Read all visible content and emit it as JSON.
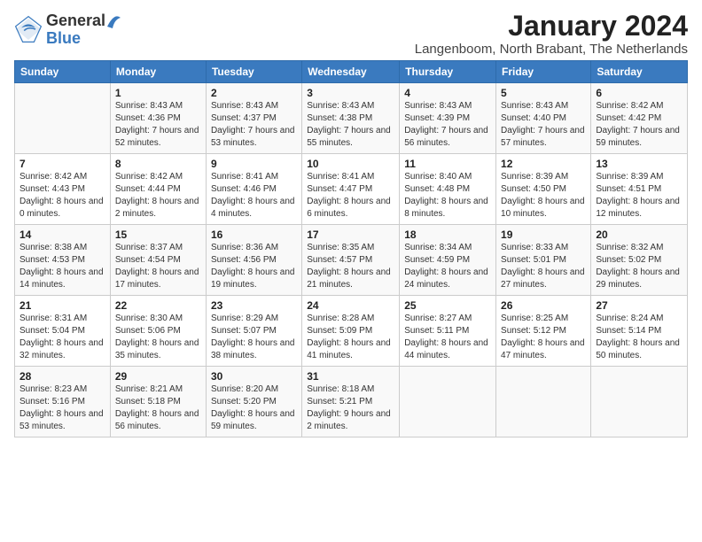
{
  "logo": {
    "general": "General",
    "blue": "Blue"
  },
  "title": "January 2024",
  "location": "Langenboom, North Brabant, The Netherlands",
  "weekdays": [
    "Sunday",
    "Monday",
    "Tuesday",
    "Wednesday",
    "Thursday",
    "Friday",
    "Saturday"
  ],
  "weeks": [
    [
      {
        "day": "",
        "sunrise": "",
        "sunset": "",
        "daylight": ""
      },
      {
        "day": "1",
        "sunrise": "Sunrise: 8:43 AM",
        "sunset": "Sunset: 4:36 PM",
        "daylight": "Daylight: 7 hours and 52 minutes."
      },
      {
        "day": "2",
        "sunrise": "Sunrise: 8:43 AM",
        "sunset": "Sunset: 4:37 PM",
        "daylight": "Daylight: 7 hours and 53 minutes."
      },
      {
        "day": "3",
        "sunrise": "Sunrise: 8:43 AM",
        "sunset": "Sunset: 4:38 PM",
        "daylight": "Daylight: 7 hours and 55 minutes."
      },
      {
        "day": "4",
        "sunrise": "Sunrise: 8:43 AM",
        "sunset": "Sunset: 4:39 PM",
        "daylight": "Daylight: 7 hours and 56 minutes."
      },
      {
        "day": "5",
        "sunrise": "Sunrise: 8:43 AM",
        "sunset": "Sunset: 4:40 PM",
        "daylight": "Daylight: 7 hours and 57 minutes."
      },
      {
        "day": "6",
        "sunrise": "Sunrise: 8:42 AM",
        "sunset": "Sunset: 4:42 PM",
        "daylight": "Daylight: 7 hours and 59 minutes."
      }
    ],
    [
      {
        "day": "7",
        "sunrise": "Sunrise: 8:42 AM",
        "sunset": "Sunset: 4:43 PM",
        "daylight": "Daylight: 8 hours and 0 minutes."
      },
      {
        "day": "8",
        "sunrise": "Sunrise: 8:42 AM",
        "sunset": "Sunset: 4:44 PM",
        "daylight": "Daylight: 8 hours and 2 minutes."
      },
      {
        "day": "9",
        "sunrise": "Sunrise: 8:41 AM",
        "sunset": "Sunset: 4:46 PM",
        "daylight": "Daylight: 8 hours and 4 minutes."
      },
      {
        "day": "10",
        "sunrise": "Sunrise: 8:41 AM",
        "sunset": "Sunset: 4:47 PM",
        "daylight": "Daylight: 8 hours and 6 minutes."
      },
      {
        "day": "11",
        "sunrise": "Sunrise: 8:40 AM",
        "sunset": "Sunset: 4:48 PM",
        "daylight": "Daylight: 8 hours and 8 minutes."
      },
      {
        "day": "12",
        "sunrise": "Sunrise: 8:39 AM",
        "sunset": "Sunset: 4:50 PM",
        "daylight": "Daylight: 8 hours and 10 minutes."
      },
      {
        "day": "13",
        "sunrise": "Sunrise: 8:39 AM",
        "sunset": "Sunset: 4:51 PM",
        "daylight": "Daylight: 8 hours and 12 minutes."
      }
    ],
    [
      {
        "day": "14",
        "sunrise": "Sunrise: 8:38 AM",
        "sunset": "Sunset: 4:53 PM",
        "daylight": "Daylight: 8 hours and 14 minutes."
      },
      {
        "day": "15",
        "sunrise": "Sunrise: 8:37 AM",
        "sunset": "Sunset: 4:54 PM",
        "daylight": "Daylight: 8 hours and 17 minutes."
      },
      {
        "day": "16",
        "sunrise": "Sunrise: 8:36 AM",
        "sunset": "Sunset: 4:56 PM",
        "daylight": "Daylight: 8 hours and 19 minutes."
      },
      {
        "day": "17",
        "sunrise": "Sunrise: 8:35 AM",
        "sunset": "Sunset: 4:57 PM",
        "daylight": "Daylight: 8 hours and 21 minutes."
      },
      {
        "day": "18",
        "sunrise": "Sunrise: 8:34 AM",
        "sunset": "Sunset: 4:59 PM",
        "daylight": "Daylight: 8 hours and 24 minutes."
      },
      {
        "day": "19",
        "sunrise": "Sunrise: 8:33 AM",
        "sunset": "Sunset: 5:01 PM",
        "daylight": "Daylight: 8 hours and 27 minutes."
      },
      {
        "day": "20",
        "sunrise": "Sunrise: 8:32 AM",
        "sunset": "Sunset: 5:02 PM",
        "daylight": "Daylight: 8 hours and 29 minutes."
      }
    ],
    [
      {
        "day": "21",
        "sunrise": "Sunrise: 8:31 AM",
        "sunset": "Sunset: 5:04 PM",
        "daylight": "Daylight: 8 hours and 32 minutes."
      },
      {
        "day": "22",
        "sunrise": "Sunrise: 8:30 AM",
        "sunset": "Sunset: 5:06 PM",
        "daylight": "Daylight: 8 hours and 35 minutes."
      },
      {
        "day": "23",
        "sunrise": "Sunrise: 8:29 AM",
        "sunset": "Sunset: 5:07 PM",
        "daylight": "Daylight: 8 hours and 38 minutes."
      },
      {
        "day": "24",
        "sunrise": "Sunrise: 8:28 AM",
        "sunset": "Sunset: 5:09 PM",
        "daylight": "Daylight: 8 hours and 41 minutes."
      },
      {
        "day": "25",
        "sunrise": "Sunrise: 8:27 AM",
        "sunset": "Sunset: 5:11 PM",
        "daylight": "Daylight: 8 hours and 44 minutes."
      },
      {
        "day": "26",
        "sunrise": "Sunrise: 8:25 AM",
        "sunset": "Sunset: 5:12 PM",
        "daylight": "Daylight: 8 hours and 47 minutes."
      },
      {
        "day": "27",
        "sunrise": "Sunrise: 8:24 AM",
        "sunset": "Sunset: 5:14 PM",
        "daylight": "Daylight: 8 hours and 50 minutes."
      }
    ],
    [
      {
        "day": "28",
        "sunrise": "Sunrise: 8:23 AM",
        "sunset": "Sunset: 5:16 PM",
        "daylight": "Daylight: 8 hours and 53 minutes."
      },
      {
        "day": "29",
        "sunrise": "Sunrise: 8:21 AM",
        "sunset": "Sunset: 5:18 PM",
        "daylight": "Daylight: 8 hours and 56 minutes."
      },
      {
        "day": "30",
        "sunrise": "Sunrise: 8:20 AM",
        "sunset": "Sunset: 5:20 PM",
        "daylight": "Daylight: 8 hours and 59 minutes."
      },
      {
        "day": "31",
        "sunrise": "Sunrise: 8:18 AM",
        "sunset": "Sunset: 5:21 PM",
        "daylight": "Daylight: 9 hours and 2 minutes."
      },
      {
        "day": "",
        "sunrise": "",
        "sunset": "",
        "daylight": ""
      },
      {
        "day": "",
        "sunrise": "",
        "sunset": "",
        "daylight": ""
      },
      {
        "day": "",
        "sunrise": "",
        "sunset": "",
        "daylight": ""
      }
    ]
  ]
}
